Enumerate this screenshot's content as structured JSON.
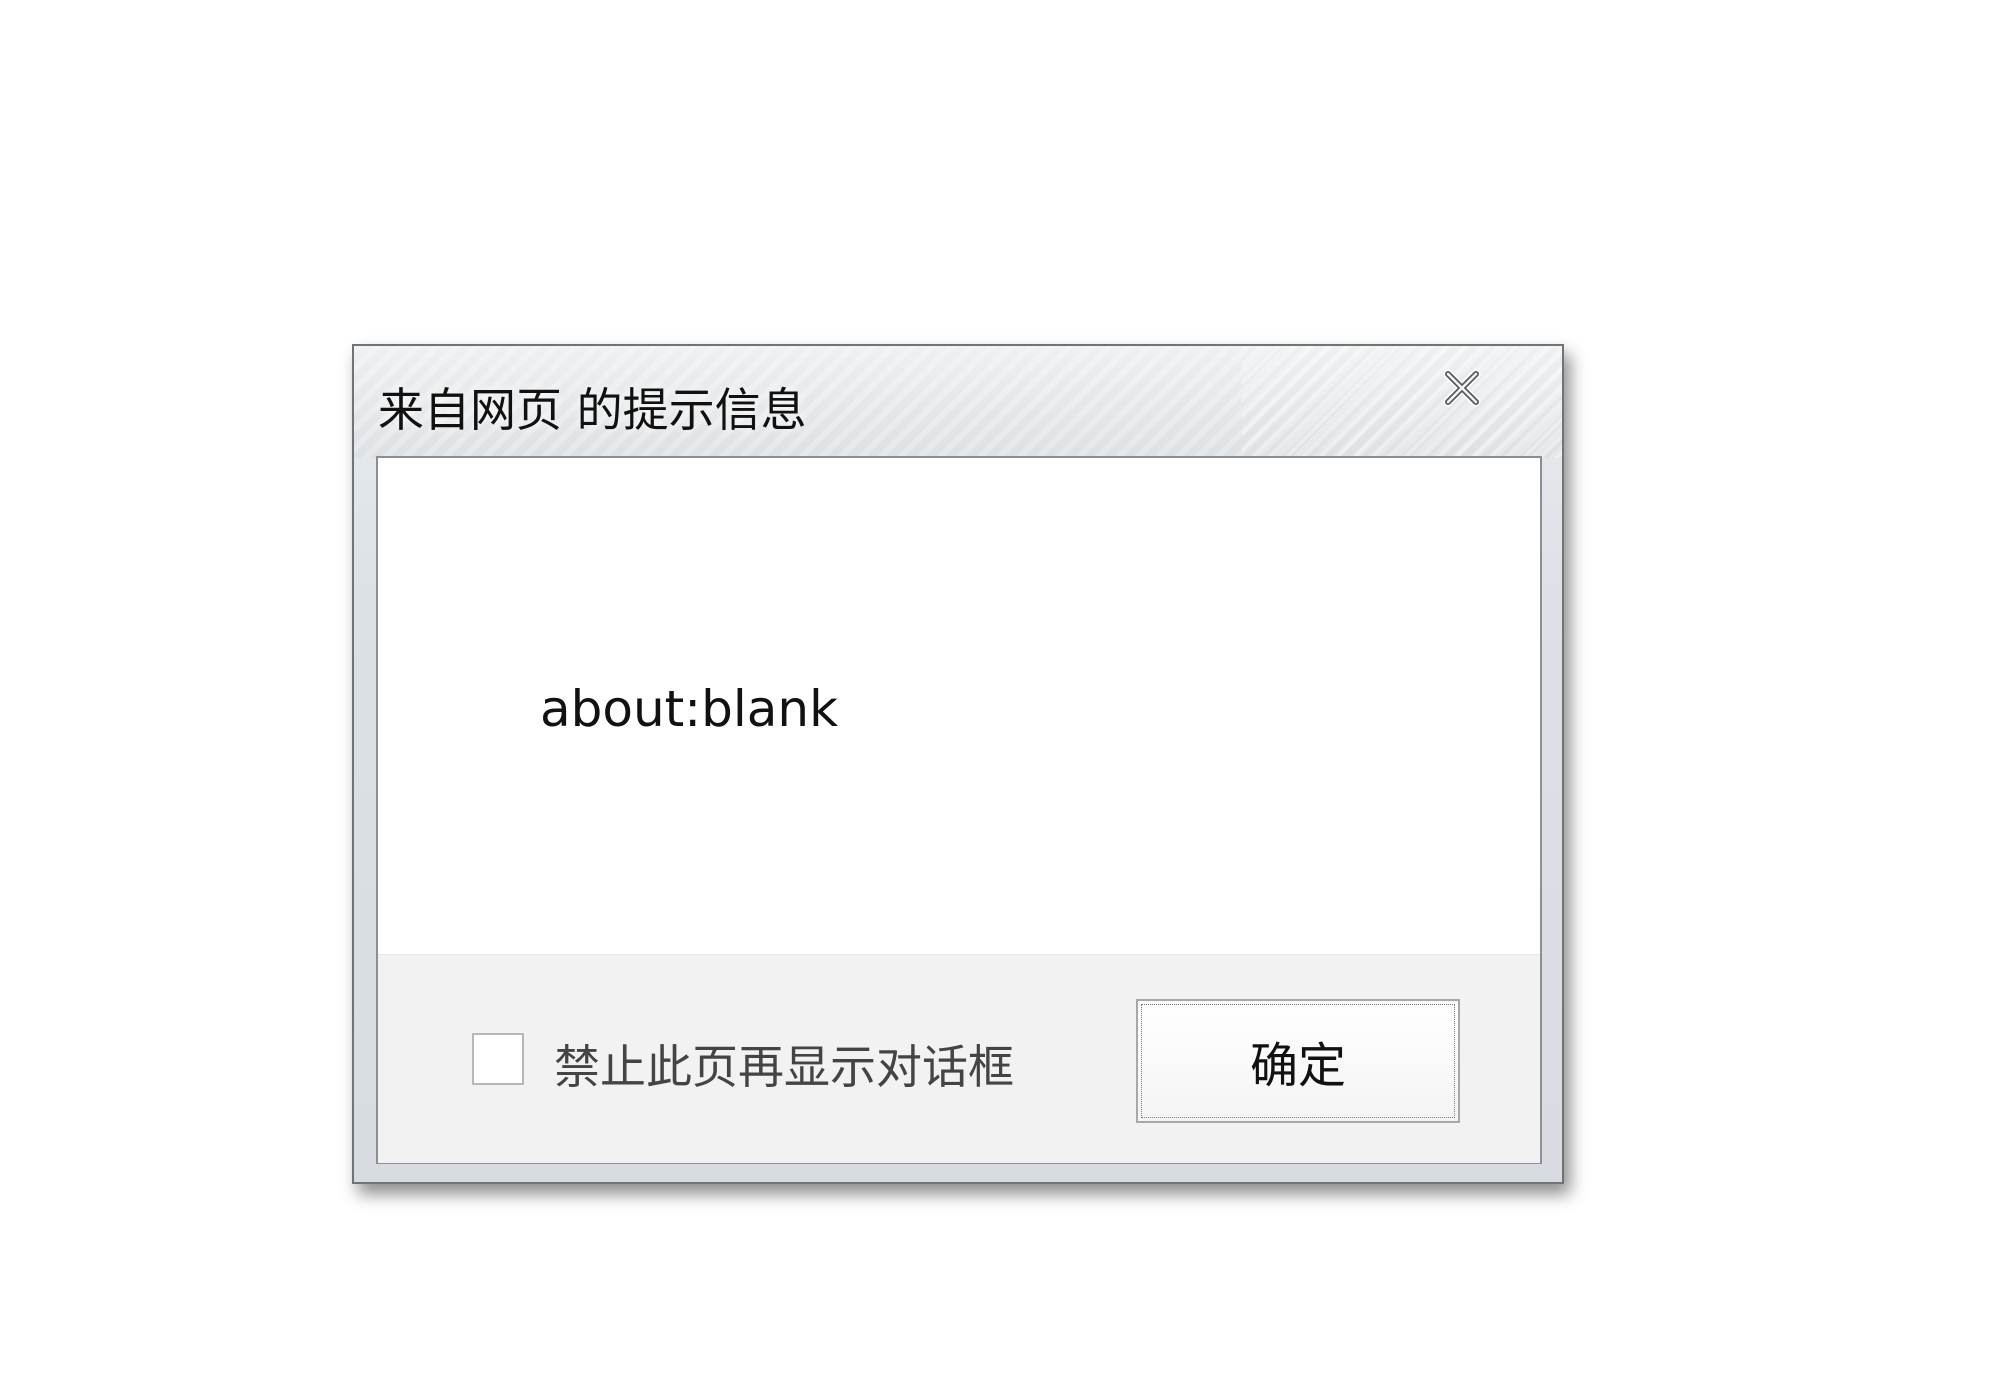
{
  "dialog": {
    "title": "来自网页 的提示信息",
    "message": "about:blank",
    "checkbox_label": "禁止此页再显示对话框",
    "checkbox_checked": false,
    "ok_label": "确定",
    "close_icon": "close-icon"
  }
}
